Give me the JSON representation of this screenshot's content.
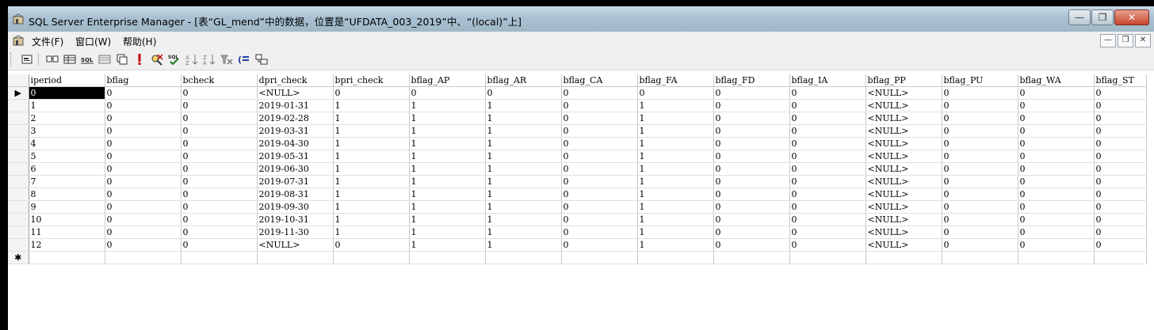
{
  "window": {
    "title": "SQL Server Enterprise Manager - [表“GL_mend”中的数据，位置是“UFDATA_003_2019”中、“(local)”上]",
    "controls": [
      "0",
      "1",
      "r"
    ]
  },
  "menu": {
    "items": [
      {
        "label": "文件(F)"
      },
      {
        "label": "窗口(W)"
      },
      {
        "label": "帮助(H)"
      }
    ]
  },
  "toolbar": {
    "buttons": [
      "properties-icon",
      "diagram-pane-icon",
      "grid-pane-icon",
      "sql-pane-icon",
      "results-pane-icon",
      "change-query-type-icon",
      "run-icon",
      "verify-sql-icon",
      "sql-check-icon",
      "sort-ascending-icon",
      "sort-descending-icon",
      "remove-filter-icon",
      "group-by-icon",
      "add-table-icon"
    ]
  },
  "grid": {
    "columns": [
      "iperiod",
      "bflag",
      "bcheck",
      "dpri_check",
      "bpri_check",
      "bflag_AP",
      "bflag_AR",
      "bflag_CA",
      "bflag_FA",
      "bflag_FD",
      "bflag_IA",
      "bflag_PP",
      "bflag_PU",
      "bflag_WA",
      "bflag_ST"
    ],
    "rows": [
      [
        "0",
        "0",
        "0",
        "<NULL>",
        "0",
        "0",
        "0",
        "0",
        "0",
        "0",
        "0",
        "<NULL>",
        "0",
        "0",
        "0"
      ],
      [
        "1",
        "0",
        "0",
        "2019-01-31",
        "1",
        "1",
        "1",
        "0",
        "1",
        "0",
        "0",
        "<NULL>",
        "0",
        "0",
        "0"
      ],
      [
        "2",
        "0",
        "0",
        "2019-02-28",
        "1",
        "1",
        "1",
        "0",
        "1",
        "0",
        "0",
        "<NULL>",
        "0",
        "0",
        "0"
      ],
      [
        "3",
        "0",
        "0",
        "2019-03-31",
        "1",
        "1",
        "1",
        "0",
        "1",
        "0",
        "0",
        "<NULL>",
        "0",
        "0",
        "0"
      ],
      [
        "4",
        "0",
        "0",
        "2019-04-30",
        "1",
        "1",
        "1",
        "0",
        "1",
        "0",
        "0",
        "<NULL>",
        "0",
        "0",
        "0"
      ],
      [
        "5",
        "0",
        "0",
        "2019-05-31",
        "1",
        "1",
        "1",
        "0",
        "1",
        "0",
        "0",
        "<NULL>",
        "0",
        "0",
        "0"
      ],
      [
        "6",
        "0",
        "0",
        "2019-06-30",
        "1",
        "1",
        "1",
        "0",
        "1",
        "0",
        "0",
        "<NULL>",
        "0",
        "0",
        "0"
      ],
      [
        "7",
        "0",
        "0",
        "2019-07-31",
        "1",
        "1",
        "1",
        "0",
        "1",
        "0",
        "0",
        "<NULL>",
        "0",
        "0",
        "0"
      ],
      [
        "8",
        "0",
        "0",
        "2019-08-31",
        "1",
        "1",
        "1",
        "0",
        "1",
        "0",
        "0",
        "<NULL>",
        "0",
        "0",
        "0"
      ],
      [
        "9",
        "0",
        "0",
        "2019-09-30",
        "1",
        "1",
        "1",
        "0",
        "1",
        "0",
        "0",
        "<NULL>",
        "0",
        "0",
        "0"
      ],
      [
        "10",
        "0",
        "0",
        "2019-10-31",
        "1",
        "1",
        "1",
        "0",
        "1",
        "0",
        "0",
        "<NULL>",
        "0",
        "0",
        "0"
      ],
      [
        "11",
        "0",
        "0",
        "2019-11-30",
        "1",
        "1",
        "1",
        "0",
        "1",
        "0",
        "0",
        "<NULL>",
        "0",
        "0",
        "0"
      ],
      [
        "12",
        "0",
        "0",
        "<NULL>",
        "0",
        "1",
        "1",
        "0",
        "1",
        "0",
        "0",
        "<NULL>",
        "0",
        "0",
        "0"
      ]
    ],
    "current_row_marker": "▶",
    "new_row_marker": "✱"
  },
  "colors": {
    "titlebar": "#a9c1d3",
    "close": "#c8452e",
    "chrome": "#f0f0f0"
  }
}
